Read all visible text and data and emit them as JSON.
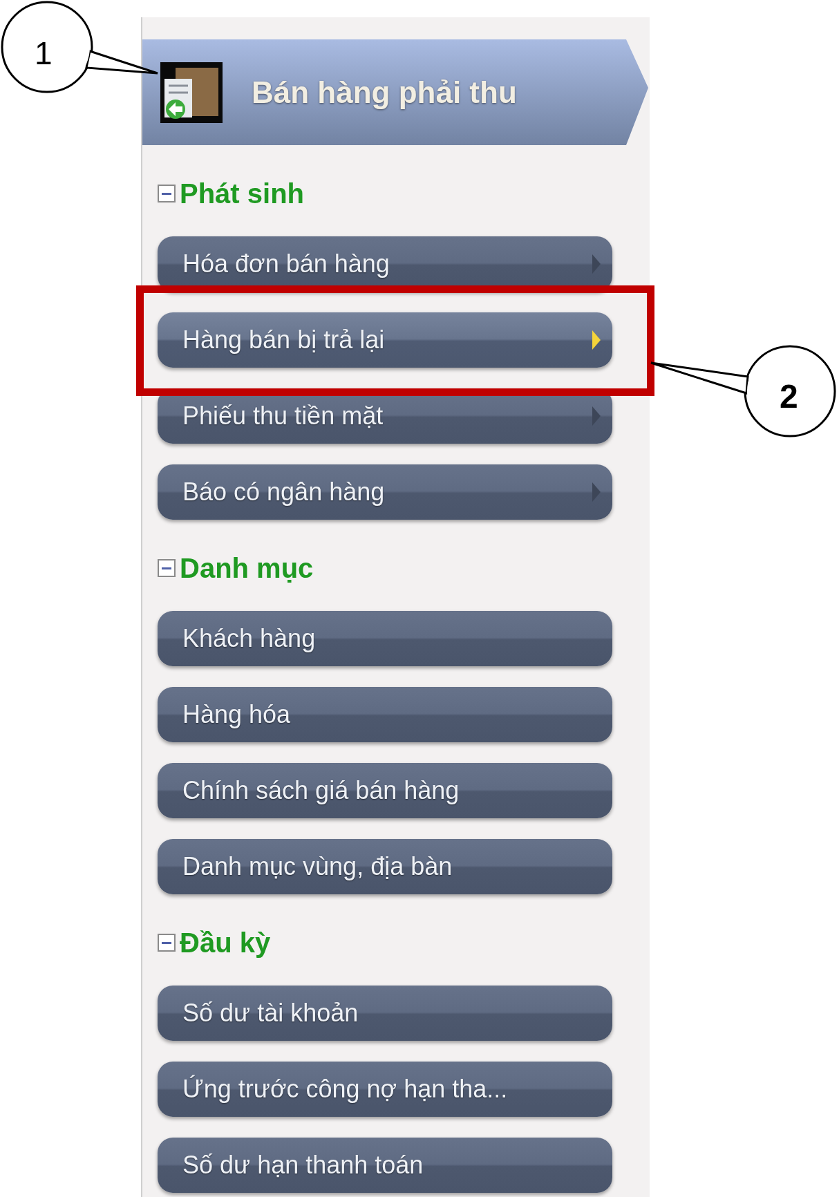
{
  "header": {
    "title": "Bán hàng phải thu"
  },
  "sections": [
    {
      "title": "Phát sinh",
      "expanded": true,
      "items": [
        {
          "label": "Hóa đơn bán hàng",
          "selected": false,
          "arrow": true
        },
        {
          "label": "Hàng bán bị trả lại",
          "selected": true,
          "arrow": true
        },
        {
          "label": "Phiếu thu tiền mặt",
          "selected": false,
          "arrow": true
        },
        {
          "label": "Báo có ngân hàng",
          "selected": false,
          "arrow": true
        }
      ]
    },
    {
      "title": "Danh mục",
      "expanded": true,
      "items": [
        {
          "label": "Khách hàng",
          "selected": false,
          "arrow": false
        },
        {
          "label": "Hàng hóa",
          "selected": false,
          "arrow": false
        },
        {
          "label": "Chính sách giá bán hàng",
          "selected": false,
          "arrow": false
        },
        {
          "label": "Danh mục vùng, địa bàn",
          "selected": false,
          "arrow": false
        }
      ]
    },
    {
      "title": "Đầu kỳ",
      "expanded": true,
      "items": [
        {
          "label": "Số dư tài khoản",
          "selected": false,
          "arrow": false
        },
        {
          "label": "Ứng trước công nợ hạn tha...",
          "selected": false,
          "arrow": false
        },
        {
          "label": "Số dư hạn thanh toán",
          "selected": false,
          "arrow": false
        }
      ]
    }
  ],
  "callouts": [
    {
      "number": "1"
    },
    {
      "number": "2"
    }
  ]
}
